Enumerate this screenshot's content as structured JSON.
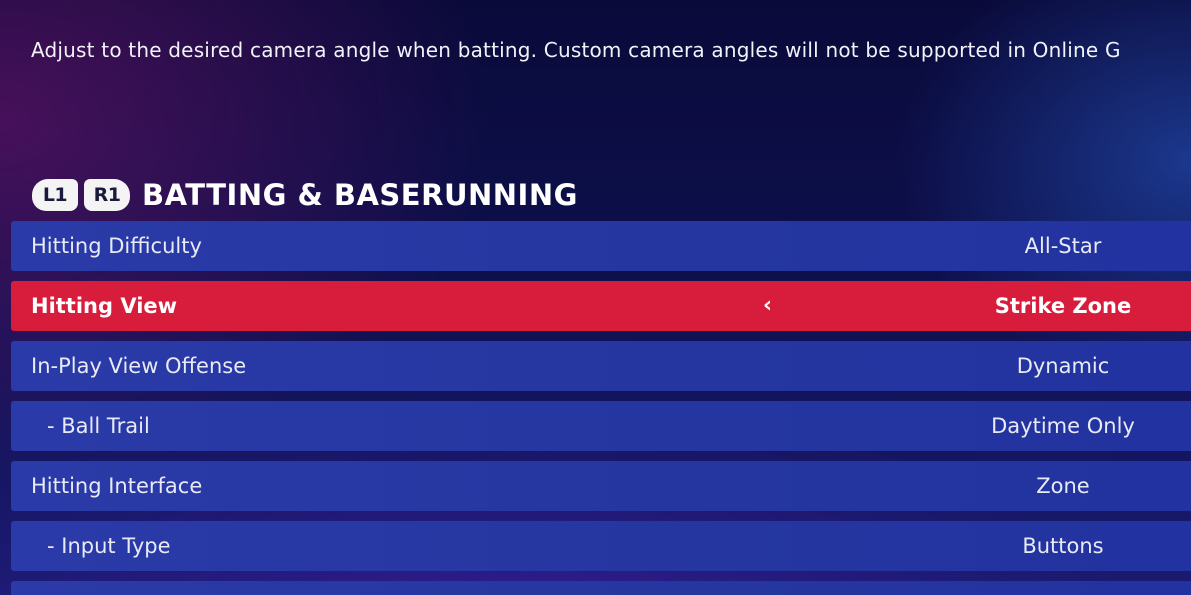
{
  "description": "Adjust to the desired camera angle when batting. Custom camera angles will not be supported in Online G",
  "section": {
    "bumper_left": "L1",
    "bumper_right": "R1",
    "title": "BATTING & BASERUNNING"
  },
  "settings": [
    {
      "label": "Hitting Difficulty",
      "value": "All-Star",
      "selected": false,
      "sub": false
    },
    {
      "label": "Hitting View",
      "value": "Strike Zone",
      "selected": true,
      "sub": false,
      "arrow": "‹"
    },
    {
      "label": "In-Play View Offense",
      "value": "Dynamic",
      "selected": false,
      "sub": false
    },
    {
      "label": "- Ball Trail",
      "value": "Daytime Only",
      "selected": false,
      "sub": true
    },
    {
      "label": "Hitting Interface",
      "value": "Zone",
      "selected": false,
      "sub": false
    },
    {
      "label": "- Input Type",
      "value": "Buttons",
      "selected": false,
      "sub": true
    }
  ],
  "colors": {
    "selected_row": "#d71c3c",
    "row": "#2536a0",
    "background": "#0d0f4a"
  }
}
